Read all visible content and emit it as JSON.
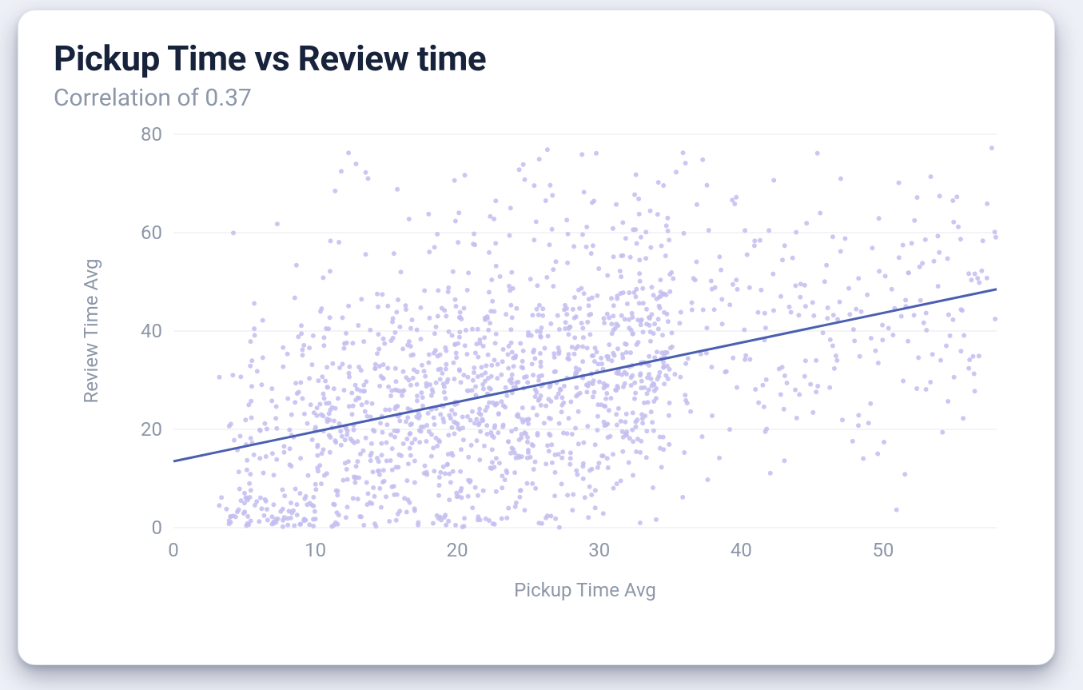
{
  "header": {
    "title": "Pickup Time vs Review time",
    "subtitle": "Correlation of 0.37"
  },
  "chart_data": {
    "type": "scatter",
    "title": "Pickup Time vs Review time",
    "subtitle": "Correlation of 0.37",
    "xlabel": "Pickup Time Avg",
    "ylabel": "Review Time Avg",
    "xlim": [
      0,
      58
    ],
    "ylim": [
      0,
      80
    ],
    "x_ticks": [
      0,
      10,
      20,
      30,
      40,
      50
    ],
    "y_ticks": [
      0,
      20,
      40,
      60,
      80
    ],
    "grid_y": true,
    "trend_line": {
      "x1": 0,
      "y1": 13.5,
      "x2": 58,
      "y2": 48.5
    },
    "n_points_approx": 1600,
    "point_color": "#c3bdf0",
    "trend_color": "#4a5fb0",
    "seed": 924711
  }
}
